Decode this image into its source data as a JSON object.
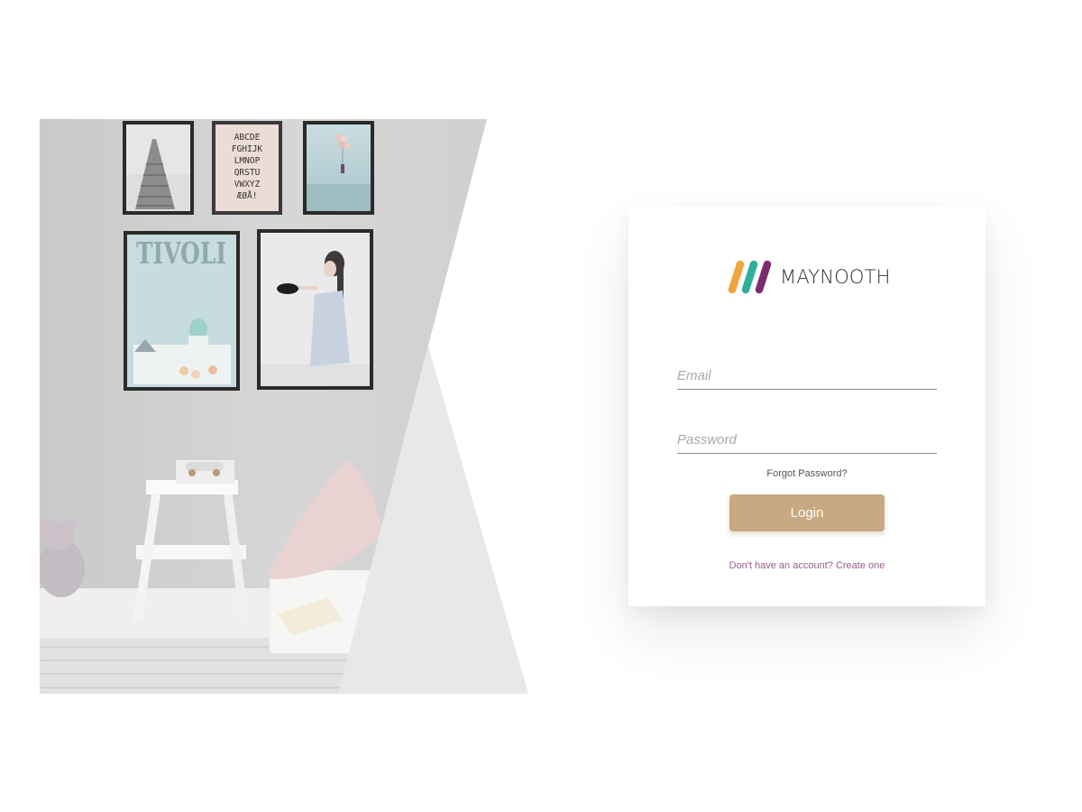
{
  "brand": {
    "name": "MAYNOOTH",
    "logo_colors": [
      "#f1a33c",
      "#2fae9a",
      "#7b2c6f"
    ]
  },
  "login": {
    "email_placeholder": "Email",
    "password_placeholder": "Password",
    "forgot_label": "Forgot Password?",
    "login_label": "Login",
    "signup_prompt": "Don't have an account?",
    "signup_link": "Create one"
  },
  "hero": {
    "poster_letters": [
      "ABCDE",
      "FGHIJK",
      "LMNOP",
      "QRSTU",
      "VWXYZ",
      "ÆØÅ!"
    ],
    "poster_title": "TIVOLI"
  },
  "colors": {
    "accent": "#c8a983",
    "link": "#9a5b8a"
  }
}
